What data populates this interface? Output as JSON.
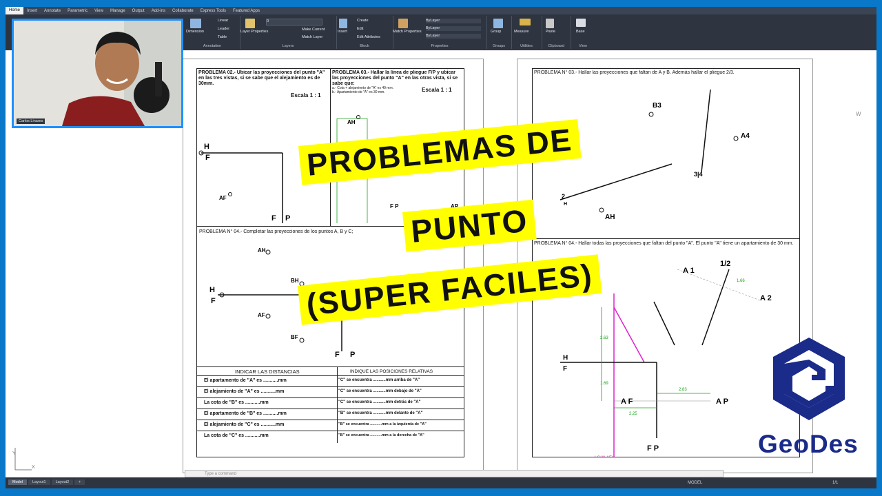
{
  "ribbon_tabs": [
    "Home",
    "Insert",
    "Annotate",
    "Parametric",
    "View",
    "Manage",
    "Output",
    "Add-ins",
    "Collaborate",
    "Express Tools",
    "Featured Apps"
  ],
  "ribbon_groups": [
    {
      "label": "Annotation",
      "tools": [
        "Dimension",
        "Linear",
        "Leader",
        "Table"
      ]
    },
    {
      "label": "Layers",
      "tools": [
        "Layer Properties",
        "Make Current",
        "Match Layer"
      ],
      "layer_value": "0"
    },
    {
      "label": "Block",
      "tools": [
        "Insert",
        "Create",
        "Edit",
        "Edit Attributes"
      ]
    },
    {
      "label": "Properties",
      "tools": [
        "Match Properties",
        "ByLayer",
        "ByLayer",
        "ByLayer"
      ]
    },
    {
      "label": "Groups",
      "tools": [
        "Group"
      ]
    },
    {
      "label": "Utilities",
      "tools": [
        "Measure"
      ]
    },
    {
      "label": "Clipboard",
      "tools": [
        "Paste"
      ]
    },
    {
      "label": "View",
      "tools": [
        "Base"
      ]
    }
  ],
  "webcam": {
    "name": "Carlos Linares"
  },
  "title_lines": [
    "PROBLEMAS DE",
    "PUNTO",
    "(SUPER FACILES)"
  ],
  "brand": {
    "name": "GeoDes",
    "color": "#1b2b8a"
  },
  "left_sheet": {
    "p02_title": "PROBLEMA 02.- Ubicar las proyecciones del punto \"A\" en las tres vistas, si se sabe que el alejamiento es de 30mm.",
    "p02_scale": "Escala 1 : 1",
    "p03_title": "PROBLEMA 03.- Hallar la línea de pliegue F/P y ubicar las proyecciones del punto \"A\" en las otras vista, si se sabe que:",
    "p03_notes": "a.- Cota + alejamiento de \"A\" es 49 mm. b.- Apartamiento de \"A\" es 30 mm.",
    "p03_scale": "Escala 1 : 1",
    "p04_title": "PROBLEMA N° 04.- Completar las proyecciones de los puntos A, B y C;",
    "table_headers": [
      "INDICAR LAS DISTANCIAS",
      "INDIQUE LAS POSICIONES RELATIVAS"
    ],
    "table_rows": [
      [
        "El apartamento de \"A\" es ...........mm",
        "\"C\" se encuentra ...........mm arriba de \"A\""
      ],
      [
        "El alejamiento de \"A\" es ...........mm",
        "\"C\" se encuentra ...........mm debajo de \"A\""
      ],
      [
        "La cota de \"B\" es ...........mm",
        "\"C\" se encuentra ...........mm detrás de \"A\""
      ],
      [
        "El apartamento de \"B\" es ...........mm",
        "\"B\" se encuentra ...........mm delante de \"A\""
      ],
      [
        "El alejamiento de \"C\" es ...........mm",
        "\"B\" se encuentra ...........mm a la izquierda de \"A\""
      ],
      [
        "La cota de \"C\" es ...........mm",
        "\"B\" se encuentra ...........mm a la derecha de \"A\""
      ]
    ]
  },
  "right_sheet": {
    "p03_title": "PROBLEMA N° 03.- Hallar las proyecciones que faltan de A y B. Además hallar el pliegue 2/3.",
    "p04_title": "PROBLEMA N° 04.- Hallar todas las proyecciones que faltan del punto \"A\". El punto \"A\" tiene un apartamiento de 30 mm.",
    "labels": {
      "b3": "B3",
      "a4": "A4",
      "ah": "AH",
      "h2": "2 H",
      "three4": "3 4",
      "a1": "A 1",
      "a2": "A 2",
      "one2": "1/2",
      "h": "H",
      "f": "F",
      "af": "A F",
      "ap": "A P",
      "fp": "F P",
      "lg": "LG(A\\ AF)"
    },
    "dims": {
      "d1": "1.66",
      "d2": "2.63",
      "d3": "1.69",
      "d4": "2.83",
      "d5": "2.25"
    }
  },
  "command_placeholder": "Type a command",
  "layout_tabs": [
    "Model",
    "Layout1",
    "Layout2"
  ],
  "status_model": "MODEL",
  "status_scale": "1/1",
  "colors": {
    "highlight": "#ffff00",
    "canvas_bg": "#ffffff",
    "ribbon_bg": "#2e3440",
    "frame": "#0a78c8"
  }
}
